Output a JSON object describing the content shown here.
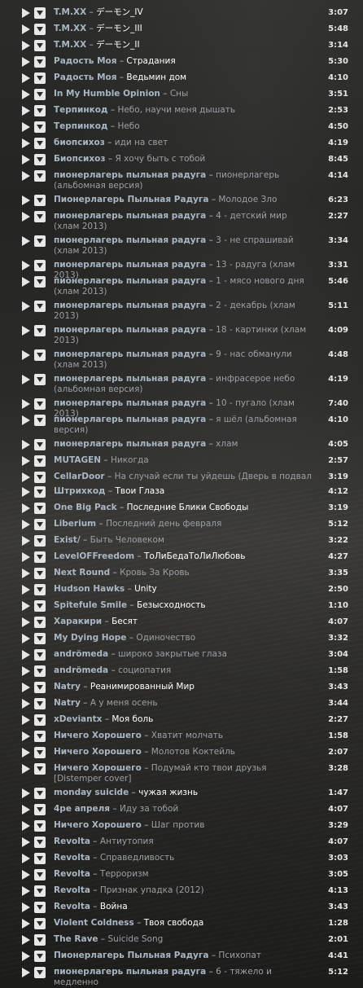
{
  "tracks": [
    {
      "artist": "T.M.XX",
      "title": "デーモン_IV",
      "duration": "3:07",
      "bright": true
    },
    {
      "artist": "T.M.XX",
      "title": "デーモン_III",
      "duration": "5:48",
      "bright": true
    },
    {
      "artist": "T.M.XX",
      "title": "デーモン_II",
      "duration": "3:14",
      "bright": true
    },
    {
      "artist": "Радость Моя",
      "title": "Страдания",
      "duration": "5:30",
      "bright": true
    },
    {
      "artist": "Радость Моя",
      "title": "Ведьмин дом",
      "duration": "4:10",
      "bright": true
    },
    {
      "artist": "In My Humble Opinion",
      "title": "Сны",
      "duration": "3:51",
      "bright": false
    },
    {
      "artist": "Терпинкод",
      "title": "Небо, научи меня дышать",
      "duration": "2:53",
      "bright": false
    },
    {
      "artist": "Терпинкод",
      "title": "Небо",
      "duration": "4:50",
      "bright": false
    },
    {
      "artist": "биопсихоз",
      "title": "иди на свет",
      "duration": "4:19",
      "bright": false
    },
    {
      "artist": "Биопсихоз",
      "title": "Я хочу быть с тобой",
      "duration": "8:45",
      "bright": false
    },
    {
      "artist": "пионерлагерь пыльная радуга",
      "title": "пионерлагерь (альбомная версия)",
      "duration": "4:14",
      "bright": false
    },
    {
      "artist": "Пионерлагерь Пыльная Радуга",
      "title": "Молодое Зло",
      "duration": "6:23",
      "bright": false
    },
    {
      "artist": "пионерлагерь пыльная радуга",
      "title": "4 - детский мир (хлам 2013)",
      "duration": "2:27",
      "bright": false
    },
    {
      "artist": "пионерлагерь пыльная радуга",
      "title": "3 - не спрашивай (хлам 2013)",
      "duration": "3:34",
      "bright": false
    },
    {
      "artist": "пионерлагерь пыльная радуга",
      "title": "13 - радуга (хлам 2013)",
      "duration": "3:31",
      "bright": false
    },
    {
      "artist": "пионерлагерь пыльная радуга",
      "title": "1 - мясо нового дня (хлам 2013)",
      "duration": "5:46",
      "bright": false
    },
    {
      "artist": "пионерлагерь пыльная радуга",
      "title": "2 - декабрь (хлам 2013)",
      "duration": "5:11",
      "bright": false
    },
    {
      "artist": "пионерлагерь пыльная радуга",
      "title": "18 - картинки (хлам 2013)",
      "duration": "4:09",
      "bright": false
    },
    {
      "artist": "пионерлагерь пыльная радуга",
      "title": "9 - нас обманули (хлам 2013)",
      "duration": "4:48",
      "bright": false
    },
    {
      "artist": "пионерлагерь пыльная радуга",
      "title": "инфрасерое небо (альбомная версия)",
      "duration": "4:19",
      "bright": false
    },
    {
      "artist": "пионерлагерь пыльная радуга",
      "title": "10 - пугало (хлам 2013)",
      "duration": "7:40",
      "bright": false
    },
    {
      "artist": "пионерлагерь пыльная радуга",
      "title": "я шёл (альбомная версия)",
      "duration": "4:10",
      "bright": false
    },
    {
      "artist": "пионерлагерь пыльная радуга",
      "title": "хлам",
      "duration": "4:05",
      "bright": false
    },
    {
      "artist": "MUTAGEN",
      "title": "Никогда",
      "duration": "2:57",
      "bright": false
    },
    {
      "artist": "CellarDoor",
      "title": "На случай если ты уйдешь (Дверь в подвал",
      "duration": "3:19",
      "bright": false
    },
    {
      "artist": "Штрихкод",
      "title": "Твои Глаза",
      "duration": "4:12",
      "bright": true
    },
    {
      "artist": "One Big Pack",
      "title": "Последние Блики Свободы",
      "duration": "3:19",
      "bright": true
    },
    {
      "artist": "Liberium",
      "title": "Последний день февраля",
      "duration": "5:12",
      "bright": false
    },
    {
      "artist": "Exist/",
      "title": "Быть Человеком",
      "duration": "3:22",
      "bright": false
    },
    {
      "artist": "LevelOFFreedom",
      "title": "ТоЛиБедаТоЛиЛюбовь",
      "duration": "4:27",
      "bright": true
    },
    {
      "artist": "Next Round",
      "title": "Кровь За Кровь",
      "duration": "3:35",
      "bright": false
    },
    {
      "artist": "Hudson Hawks",
      "title": "Unity",
      "duration": "2:50",
      "bright": true
    },
    {
      "artist": "Spitefule Smile",
      "title": "Безысходность",
      "duration": "1:10",
      "bright": true
    },
    {
      "artist": "Харакири",
      "title": "Бесят",
      "duration": "4:07",
      "bright": true
    },
    {
      "artist": "My Dying Hope",
      "title": "Одиночество",
      "duration": "3:32",
      "bright": false
    },
    {
      "artist": "andrömeda",
      "title": "широко закрытые глаза",
      "duration": "3:04",
      "bright": false
    },
    {
      "artist": "andrömeda",
      "title": "социопатия",
      "duration": "1:58",
      "bright": false
    },
    {
      "artist": "Natry",
      "title": "Реанимированный Мир",
      "duration": "3:43",
      "bright": true
    },
    {
      "artist": "Natry",
      "title": "А у меня осень",
      "duration": "3:44",
      "bright": false
    },
    {
      "artist": "xDeviantx",
      "title": "Моя боль",
      "duration": "2:27",
      "bright": true
    },
    {
      "artist": "Ничего Хорошего",
      "title": "Хватит молчать",
      "duration": "1:58",
      "bright": false
    },
    {
      "artist": "Ничего Хорошего",
      "title": "Молотов Коктейль",
      "duration": "2:07",
      "bright": false
    },
    {
      "artist": "Ничего Хорошего",
      "title": "Подумай кто твои друзья [Distemper cover]",
      "duration": "3:28",
      "bright": false
    },
    {
      "artist": "monday suicide",
      "title": "чужая жизнь",
      "duration": "1:47",
      "bright": true
    },
    {
      "artist": "4ре апреля",
      "title": "Иду за тобой",
      "duration": "4:07",
      "bright": false
    },
    {
      "artist": "Ничего Хорошего",
      "title": "Шаг против",
      "duration": "3:29",
      "bright": false
    },
    {
      "artist": "Revolta",
      "title": "Антиутопия",
      "duration": "4:07",
      "bright": false
    },
    {
      "artist": "Revolta",
      "title": "Справедливость",
      "duration": "3:03",
      "bright": false
    },
    {
      "artist": "Revolta",
      "title": "Терроризм",
      "duration": "3:05",
      "bright": false
    },
    {
      "artist": "Revolta",
      "title": "Признак упадка (2012)",
      "duration": "4:13",
      "bright": false
    },
    {
      "artist": "Revolta",
      "title": "Война",
      "duration": "3:43",
      "bright": true
    },
    {
      "artist": "Violent Coldness",
      "title": "Твоя свобода",
      "duration": "1:28",
      "bright": true
    },
    {
      "artist": "The Rave",
      "title": "Suicide Song",
      "duration": "2:01",
      "bright": false
    },
    {
      "artist": "Пионерлагерь Пыльная Радуга",
      "title": "Психопат",
      "duration": "4:41",
      "bright": false
    },
    {
      "artist": "пионерлагерь пыльная радуга",
      "title": "6 - тяжело и медленно",
      "duration": "5:12",
      "bright": false
    }
  ]
}
